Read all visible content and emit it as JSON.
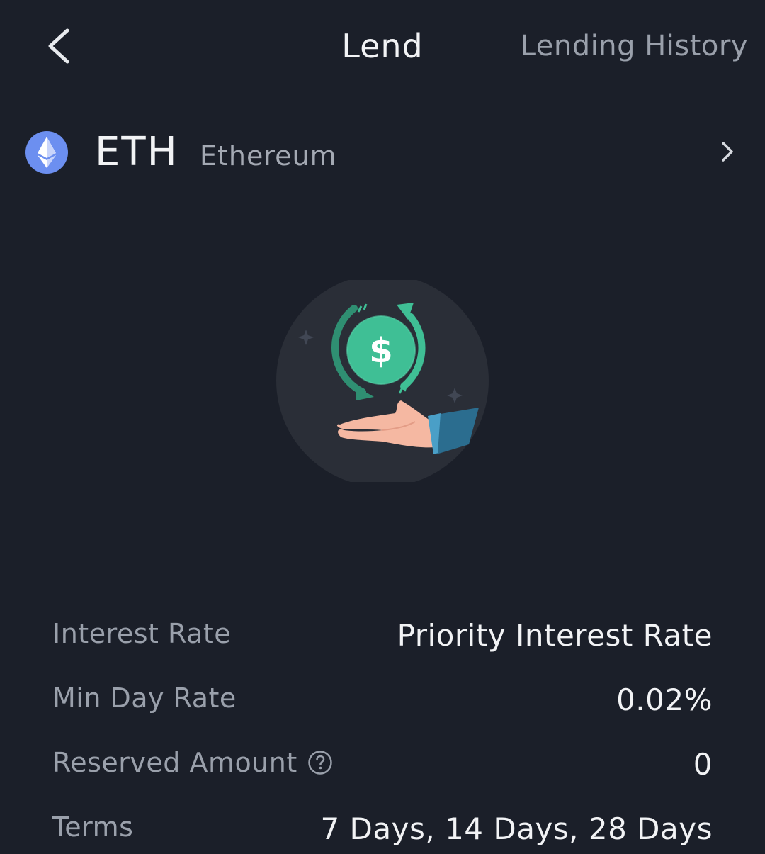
{
  "header": {
    "back_icon": "chevron-left-icon",
    "title": "Lend",
    "history_link": "Lending History"
  },
  "coin": {
    "icon": "ethereum-icon",
    "symbol": "ETH",
    "name": "Ethereum",
    "chevron_icon": "chevron-right-icon"
  },
  "illustration": {
    "icon": "lend-hand-dollar-icon",
    "dollar_glyph": "$"
  },
  "details": [
    {
      "label": "Interest Rate",
      "value": "Priority Interest Rate"
    },
    {
      "label": "Min Day Rate",
      "value": "0.02%"
    },
    {
      "label": "Reserved Amount",
      "value": "0",
      "help_icon": "question-circle-icon"
    },
    {
      "label": "Terms",
      "value": "7 Days, 14 Days, 28 Days"
    }
  ],
  "colors": {
    "background": "#1b1f29",
    "accent_green": "#3fbf95",
    "eth_blue": "#6c8ff0",
    "muted_text": "#9aa0ab"
  }
}
